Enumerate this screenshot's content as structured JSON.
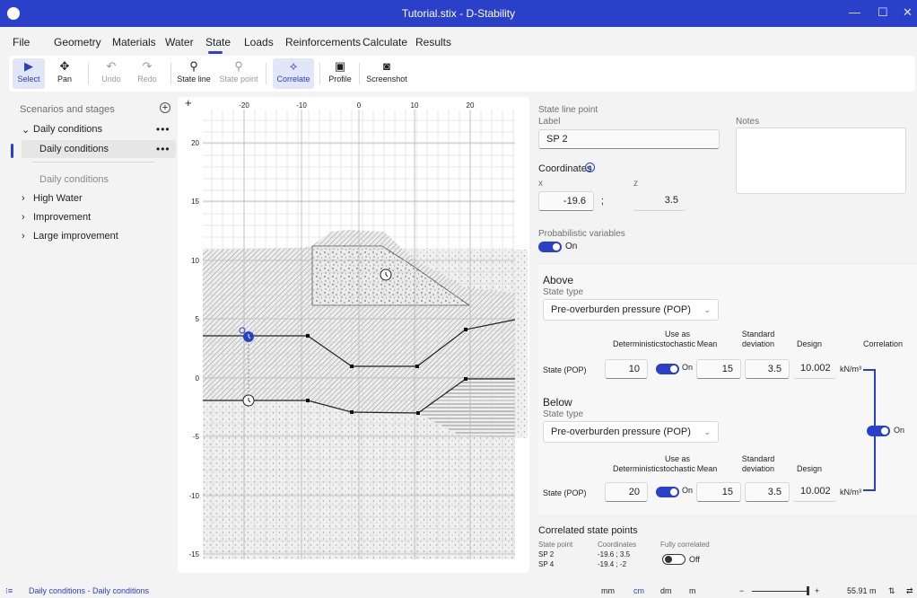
{
  "window": {
    "title": "Tutorial.stix - D-Stability"
  },
  "menu": [
    "File",
    "Geometry",
    "Materials",
    "Water",
    "State",
    "Loads",
    "Reinforcements",
    "Calculate",
    "Results"
  ],
  "toolbar": {
    "select": "Select",
    "pan": "Pan",
    "undo": "Undo",
    "redo": "Redo",
    "state_line": "State line",
    "state_point": "State point",
    "correlate": "Correlate",
    "profile": "Profile",
    "screenshot": "Screenshot"
  },
  "sidebar": {
    "title": "Scenarios and stages",
    "scenario_1": "Daily conditions",
    "stage_1": "Daily conditions",
    "stage_input": "Daily conditions",
    "scenario_2": "High Water",
    "scenario_3": "Improvement",
    "scenario_4": "Large improvement",
    "more": "•••"
  },
  "canvas": {
    "x_ticks": [
      "-20",
      "-10",
      "0",
      "10",
      "20"
    ],
    "y_ticks": [
      "20",
      "15",
      "10",
      "5",
      "0",
      "-5",
      "-10",
      "-15"
    ],
    "plus": "+"
  },
  "props": {
    "header": "State line point",
    "label_caption": "Label",
    "label_value": "SP 2",
    "notes_caption": "Notes",
    "coordinates_caption": "Coordinates",
    "x_caption": "x",
    "z_caption": "z",
    "x_value": "-19.6",
    "sep": ";",
    "z_value": "3.5",
    "prob_caption": "Probabilistic variables",
    "on": "On",
    "off": "Off"
  },
  "above": {
    "heading": "Above",
    "state_type_caption": "State type",
    "state_type": "Pre-overburden pressure (POP)",
    "row_label": "State (POP)",
    "deterministic": "10",
    "mean": "15",
    "std": "3.5",
    "design": "10.002",
    "unit": "kN/m³"
  },
  "below": {
    "heading": "Below",
    "state_type_caption": "State type",
    "state_type": "Pre-overburden pressure (POP)",
    "row_label": "State (POP)",
    "deterministic": "20",
    "mean": "15",
    "std": "3.5",
    "design": "10.002",
    "unit": "kN/m³"
  },
  "columns": {
    "deterministic": "Deterministic",
    "use_as_1": "Use as",
    "use_as_2": "stochastic",
    "mean": "Mean",
    "std_1": "Standard",
    "std_2": "deviation",
    "design": "Design",
    "correlation": "Correlation"
  },
  "correlated": {
    "heading": "Correlated state points",
    "col_point": "State point",
    "col_coords": "Coordinates",
    "col_fully": "Fully correlated",
    "rows": [
      {
        "point": "SP 2",
        "coords": "-19.6 ; 3.5"
      },
      {
        "point": "SP 4",
        "coords": "-19.4 ; -2"
      }
    ]
  },
  "status": {
    "breadcrumb": "Daily conditions - Daily conditions",
    "units": [
      "mm",
      "cm",
      "dm",
      "m"
    ],
    "zoom": "55.91 m",
    "minus": "−",
    "plus": "+"
  },
  "colors": {
    "accent": "#2b40c8",
    "titlebar": "#2b40c8"
  }
}
